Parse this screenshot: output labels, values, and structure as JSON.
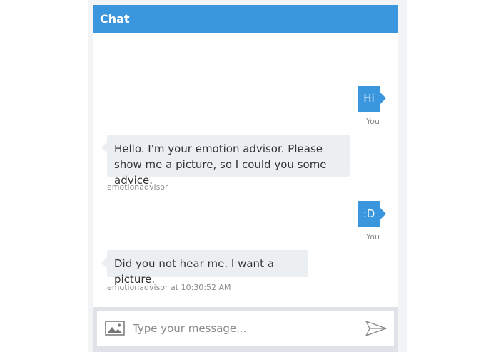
{
  "header": {
    "title": "Chat"
  },
  "messages": [
    {
      "text": "Hi",
      "from": "You"
    },
    {
      "text": "Hello. I'm your emotion advisor. Please show me a picture, so I could you some advice.",
      "from": "emotionadvisor"
    },
    {
      "text": ":D",
      "from": "You"
    },
    {
      "text": "Did you not hear me. I want a picture.",
      "from": "emotionadvisor at 10:30:52 AM"
    }
  ],
  "composer": {
    "placeholder": "Type your message..."
  },
  "icons": {
    "upload": "image-icon",
    "send": "send-icon"
  },
  "colors": {
    "accent": "#3a96dd",
    "bot_bubble": "#eceff1"
  }
}
